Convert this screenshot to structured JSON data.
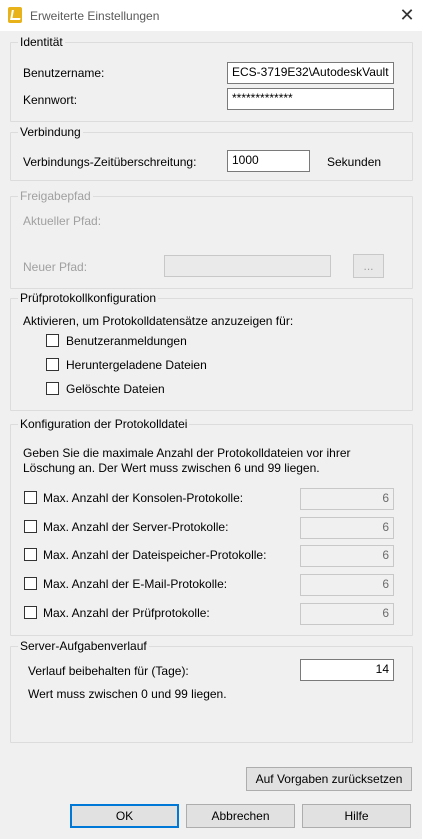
{
  "window": {
    "title": "Erweiterte Einstellungen",
    "close_glyph": "✕"
  },
  "identity": {
    "legend": "Identität",
    "username_label": "Benutzername:",
    "username_value": "ECS-3719E32\\AutodeskVault",
    "password_label": "Kennwort:",
    "password_value": "*************"
  },
  "connection": {
    "legend": "Verbindung",
    "timeout_label": "Verbindungs-Zeitüberschreitung:",
    "timeout_value": "1000",
    "unit": "Sekunden"
  },
  "share": {
    "legend": "Freigabepfad",
    "current_label": "Aktueller Pfad:",
    "new_label": "Neuer Pfad:",
    "new_value": "",
    "browse_label": "..."
  },
  "audit": {
    "legend": "Prüfprotokollkonfiguration",
    "description": "Aktivieren, um Protokolldatensätze anzuzeigen für:",
    "items": [
      {
        "label": "Benutzeranmeldungen",
        "checked": false
      },
      {
        "label": "Heruntergeladene Dateien",
        "checked": false
      },
      {
        "label": "Gelöschte Dateien",
        "checked": false
      }
    ]
  },
  "logfile": {
    "legend": "Konfiguration der Protokolldatei",
    "description_line1": "Geben Sie die maximale Anzahl der Protokolldateien vor ihrer",
    "description_line2": "Löschung an. Der Wert muss zwischen 6 und 99 liegen.",
    "rows": [
      {
        "label": "Max. Anzahl der Konsolen-Protokolle:",
        "value": "6",
        "checked": false
      },
      {
        "label": "Max. Anzahl der Server-Protokolle:",
        "value": "6",
        "checked": false
      },
      {
        "label": "Max. Anzahl der Dateispeicher-Protokolle:",
        "value": "6",
        "checked": false
      },
      {
        "label": "Max. Anzahl der E-Mail-Protokolle:",
        "value": "6",
        "checked": false
      },
      {
        "label": "Max. Anzahl der Prüfprotokolle:",
        "value": "6",
        "checked": false
      }
    ]
  },
  "tasks": {
    "legend": "Server-Aufgabenverlauf",
    "keep_label": "Verlauf beibehalten für (Tage):",
    "keep_value": "14",
    "hint": "Wert muss zwischen 0 und 99 liegen."
  },
  "buttons": {
    "reset": "Auf Vorgaben zurücksetzen",
    "ok": "OK",
    "cancel": "Abbrechen",
    "help": "Hilfe"
  }
}
